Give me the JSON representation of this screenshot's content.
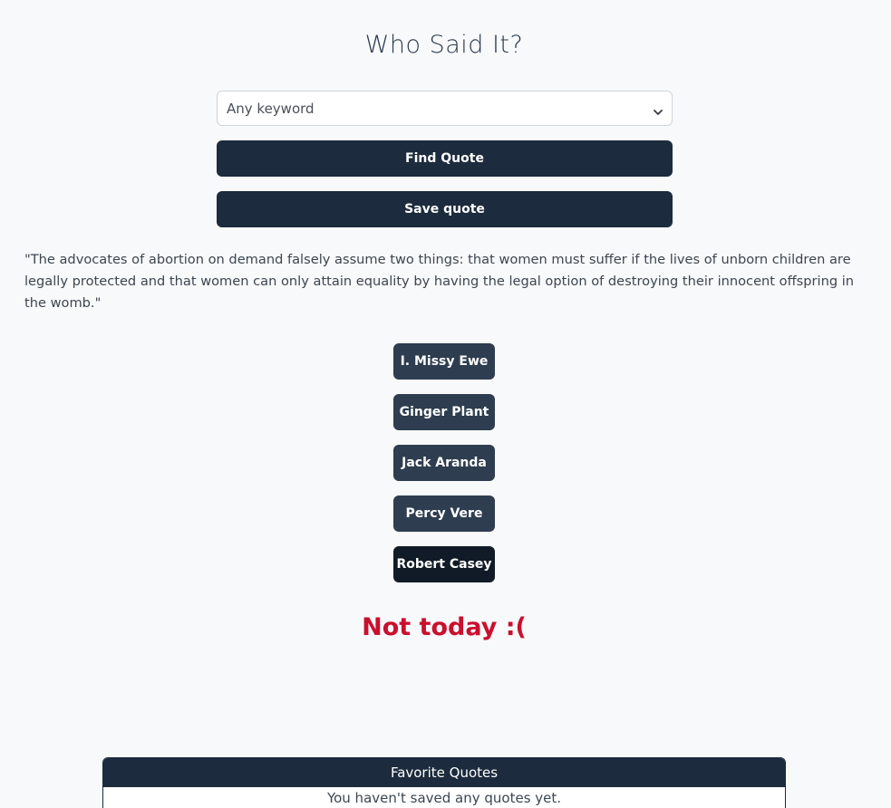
{
  "header": {
    "title": "Who Said It?"
  },
  "search": {
    "keyword_selected": "Any keyword"
  },
  "actions": {
    "find_label": "Find Quote",
    "save_label": "Save quote"
  },
  "quote": {
    "text": "\"The advocates of abortion on demand falsely assume two things: that women must suffer if the lives of unborn children are legally protected and that women can only attain equality by having the legal option of destroying their innocent offspring in the womb.\""
  },
  "answers": [
    {
      "label": "I. Missy Ewe"
    },
    {
      "label": "Ginger Plant"
    },
    {
      "label": "Jack Aranda"
    },
    {
      "label": "Percy Vere"
    },
    {
      "label": "Robert Casey"
    }
  ],
  "result": {
    "message": "Not today :("
  },
  "favorites": {
    "header": "Favorite Quotes",
    "empty_message": "You haven't saved any quotes yet."
  },
  "colors": {
    "primary": "#1c2b3d",
    "error": "#c9102e",
    "background": "#f8f9fa"
  },
  "icons": {
    "select_arrow": "chevron-down-icon"
  }
}
